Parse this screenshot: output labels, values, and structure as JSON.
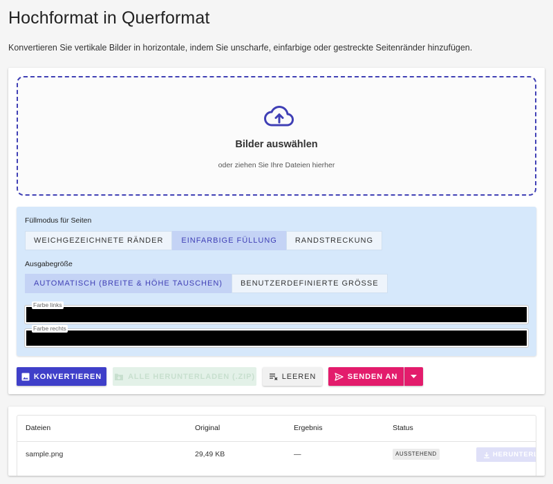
{
  "page": {
    "title": "Hochformat in Querformat",
    "subtitle": "Konvertieren Sie vertikale Bilder in horizontale, indem Sie unscharfe, einfarbige oder gestreckte Seitenränder hinzufügen."
  },
  "dropzone": {
    "icon": "cloud-upload-icon",
    "title": "Bilder auswählen",
    "subtitle": "oder ziehen Sie Ihre Dateien hierher"
  },
  "options": {
    "fill_mode": {
      "label": "Füllmodus für Seiten",
      "options": [
        "Weichgezeichnete Ränder",
        "Einfarbige Füllung",
        "Randstreckung"
      ],
      "selected": "Einfarbige Füllung"
    },
    "output_size": {
      "label": "Ausgabegröße",
      "options": [
        "Automatisch (Breite & Höhe tauschen)",
        "Benutzerdefinierte Größe"
      ],
      "selected": "Automatisch (Breite & Höhe tauschen)"
    },
    "color_left": {
      "label": "Farbe links",
      "value": "#000000"
    },
    "color_right": {
      "label": "Farbe rechts",
      "value": "#000000"
    }
  },
  "actions": {
    "convert": "Konvertieren",
    "download_all": "Alle herunterladen (.zip)",
    "clear": "Leeren",
    "send_to": "Senden an"
  },
  "table": {
    "headers": [
      "Dateien",
      "Original",
      "Ergebnis",
      "Status"
    ],
    "rows": [
      {
        "file": "sample.png",
        "original": "29,49 KB",
        "result": "—",
        "status": "AUSSTEHEND",
        "download": "HERUNTERLA"
      }
    ]
  },
  "colors": {
    "primary": "#3f3fc9",
    "accent": "#e31c6c",
    "options_bg": "#d6e8fb"
  }
}
